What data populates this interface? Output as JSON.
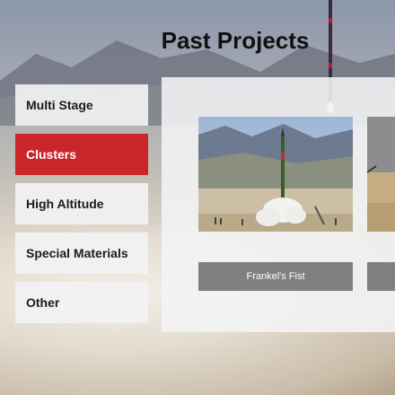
{
  "page": {
    "title": "Past Projects"
  },
  "sidebar": {
    "items": [
      {
        "label": "Multi Stage",
        "active": false
      },
      {
        "label": "Clusters",
        "active": true
      },
      {
        "label": "High Altitude",
        "active": false
      },
      {
        "label": "Special Materials",
        "active": false
      },
      {
        "label": "Other",
        "active": false
      }
    ]
  },
  "projects": [
    {
      "name": "Frankel's Fist"
    },
    {
      "name": ""
    }
  ],
  "colors": {
    "accent": "#c9252a",
    "button": "#7f7f7f"
  }
}
